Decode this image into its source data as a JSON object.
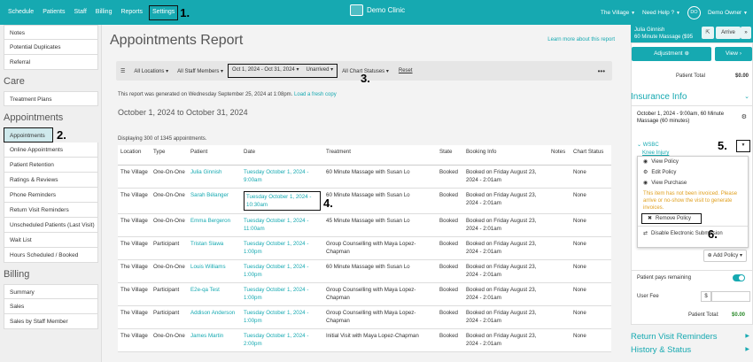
{
  "topnav": {
    "items": [
      "Schedule",
      "Patients",
      "Staff",
      "Billing",
      "Reports",
      "Settings"
    ],
    "step1": "1.",
    "brand": "Demo Clinic",
    "location": "The Village",
    "help": "Need Help ?",
    "avatar_initials": "DO",
    "user": "Demo Owner"
  },
  "sidebar": {
    "top_items": [
      "Notes",
      "Potential Duplicates",
      "Referral"
    ],
    "care_title": "Care",
    "care_items": [
      "Treatment Plans"
    ],
    "appointments_title": "Appointments",
    "appointments_active": "Appointments",
    "step2": "2.",
    "appointments_items": [
      "Online Appointments",
      "Patient Retention",
      "Ratings & Reviews",
      "Phone Reminders",
      "Return Visit Reminders",
      "Unscheduled Patients (Last Visit)",
      "Wait List",
      "Hours Scheduled / Booked"
    ],
    "billing_title": "Billing",
    "billing_items": [
      "Summary",
      "Sales",
      "Sales by Staff Member"
    ]
  },
  "main": {
    "title": "Appointments Report",
    "learn_more": "Learn more about this report",
    "filters": {
      "locations": "All Locations",
      "staff": "All Staff Members",
      "date": "Oct 1, 2024 - Oct 31, 2024",
      "status": "Unarrived",
      "chart_statuses": "All Chart Statuses",
      "reset": "Reset",
      "more": "•••",
      "step3": "3."
    },
    "generated_text": "This report was generated on Wednesday September 25, 2024 at 1:08pm.",
    "fresh_copy": "Load a fresh copy",
    "date_range": "October 1, 2024 to October 31, 2024",
    "displaying": "Displaying 300 of 1345 appointments.",
    "step4": "4.",
    "table": {
      "headers": [
        "Location",
        "Type",
        "Patient",
        "Date",
        "Treatment",
        "State",
        "Booking Info",
        "Notes",
        "Chart Status"
      ],
      "rows": [
        {
          "location": "The Village",
          "type": "One-On-One",
          "patient": "Julia Ginnish",
          "date": "Tuesday October 1, 2024 - 9:00am",
          "treatment": "60 Minute Massage with Susan Lo",
          "state": "Booked",
          "booking": "Booked on Friday August 23, 2024 - 2:01am",
          "notes": "",
          "chart": "None"
        },
        {
          "location": "The Village",
          "type": "One-On-One",
          "patient": "Sarah Bélanger",
          "date": "Tuesday October 1, 2024 - 10:30am",
          "treatment": "60 Minute Massage with Susan Lo",
          "state": "Booked",
          "booking": "Booked on Friday August 23, 2024 - 2:01am",
          "notes": "",
          "chart": "None"
        },
        {
          "location": "The Village",
          "type": "One-On-One",
          "patient": "Emma Bergeron",
          "date": "Tuesday October 1, 2024 - 11:00am",
          "treatment": "45 Minute Massage with Susan Lo",
          "state": "Booked",
          "booking": "Booked on Friday August 23, 2024 - 2:01am",
          "notes": "",
          "chart": "None"
        },
        {
          "location": "The Village",
          "type": "Participant",
          "patient": "Tristan Slawa",
          "date": "Tuesday October 1, 2024 - 1:00pm",
          "treatment": "Group Counselling with Maya Lopez-Chapman",
          "state": "Booked",
          "booking": "Booked on Friday August 23, 2024 - 2:01am",
          "notes": "",
          "chart": "None"
        },
        {
          "location": "The Village",
          "type": "One-On-One",
          "patient": "Louis Williams",
          "date": "Tuesday October 1, 2024 - 1:00pm",
          "treatment": "60 Minute Massage with Susan Lo",
          "state": "Booked",
          "booking": "Booked on Friday August 23, 2024 - 2:01am",
          "notes": "",
          "chart": "None"
        },
        {
          "location": "The Village",
          "type": "Participant",
          "patient": "E2e-qa Test",
          "date": "Tuesday October 1, 2024 - 1:00pm",
          "treatment": "Group Counselling with Maya Lopez-Chapman",
          "state": "Booked",
          "booking": "Booked on Friday August 23, 2024 - 2:01am",
          "notes": "",
          "chart": "None"
        },
        {
          "location": "The Village",
          "type": "Participant",
          "patient": "Addison Anderson",
          "date": "Tuesday October 1, 2024 - 1:00pm",
          "treatment": "Group Counselling with Maya Lopez-Chapman",
          "state": "Booked",
          "booking": "Booked on Friday August 23, 2024 - 2:01am",
          "notes": "",
          "chart": "None"
        },
        {
          "location": "The Village",
          "type": "One-On-One",
          "patient": "James Martin",
          "date": "Tuesday October 1, 2024 - 2:00pm",
          "treatment": "Initial Visit with Maya Lopez-Chapman",
          "state": "Booked",
          "booking": "Booked on Friday August 23, 2024 - 2:01am",
          "notes": "",
          "chart": "None"
        }
      ]
    }
  },
  "panel": {
    "patient_name": "Julia Ginnish",
    "patient_service": "60 Minute Massage ($95",
    "arrive": "Arrive",
    "adjustment": "Adjustment",
    "view": "View",
    "patient_balance_label": "Patient Total",
    "patient_balance_value": "$0.00",
    "insurance_title": "Insurance Info",
    "ins_date": "October 1, 2024 - 9:00am, 60 Minute Massage (60 minutes)",
    "ins_name": "WSBC",
    "ins_policy": "Knee Injury",
    "step5": "5.",
    "menu": {
      "view_policy": "View Policy",
      "edit_policy": "Edit Policy",
      "view_purchase": "View Purchase",
      "warning": "This item has not been invoiced. Please arrive or no-show the visit to generate invoices.",
      "remove_policy": "Remove Policy",
      "step6": "6.",
      "disable": "Disable Electronic Submission"
    },
    "add_policy": "Add Policy",
    "pays_remaining": "Patient pays remaining",
    "user_fee": "User Fee",
    "dollar": "$",
    "patient_total_label": "Patient Total:",
    "patient_total_value": "$0.00",
    "return_visit": "Return Visit Reminders",
    "history": "History & Status"
  }
}
